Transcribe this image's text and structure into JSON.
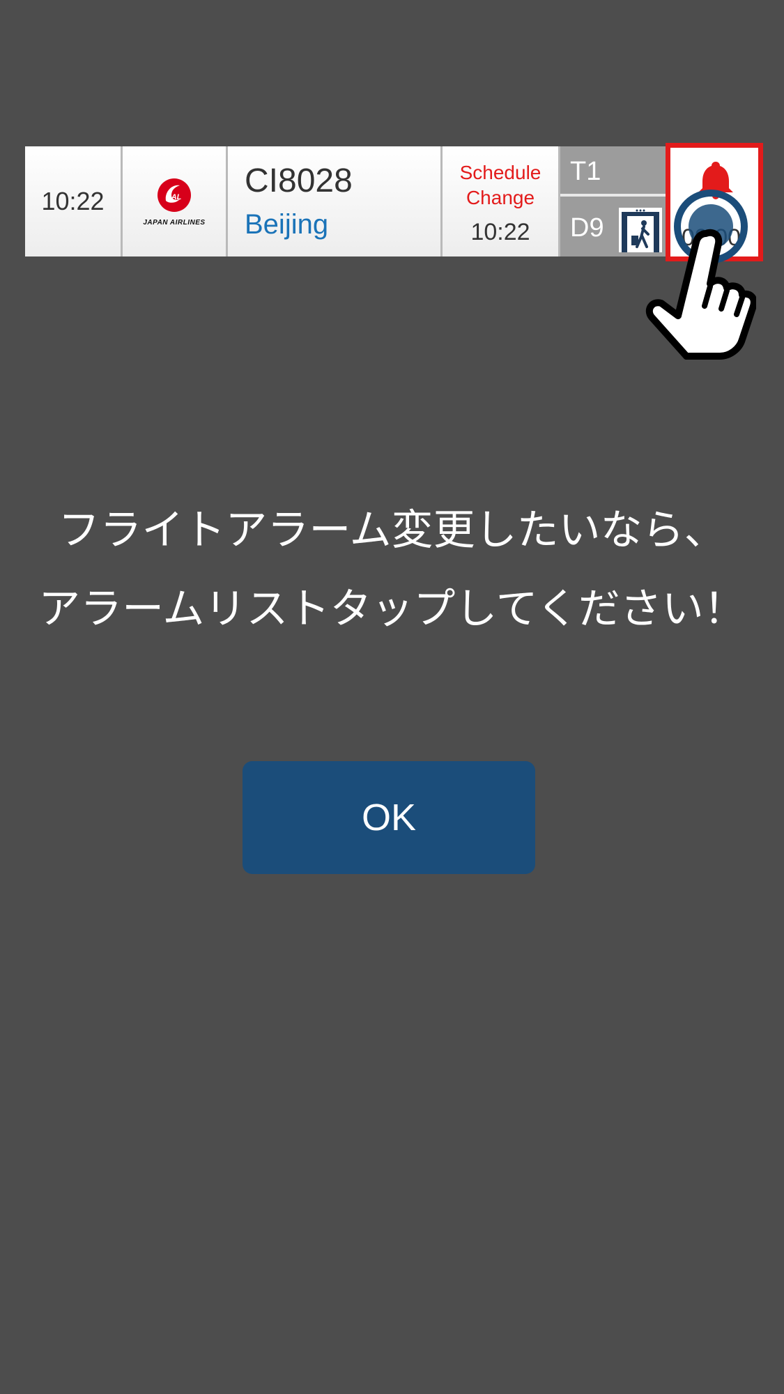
{
  "flight": {
    "scheduled_time": "10:22",
    "airline_logo_text": "JAL",
    "airline_wordmark": "JAPAN AIRLINES",
    "flight_number": "CI8028",
    "destination": "Beijing",
    "status_label": "Schedule\nChange",
    "status_time": "10:22",
    "terminal": "T1",
    "gate": "D9",
    "gate_icon": "boarding-gate-icon",
    "alarm_icon": "bell-icon",
    "alarm_time": "09:00"
  },
  "dialog": {
    "message_line1": "フライトアラーム変更したいなら、",
    "message_line2": "アラームリストタップしてください！",
    "ok_label": "OK"
  },
  "overlay": {
    "pointer_icon": "hand-pointer-icon",
    "tap_indicator": "tap-ring-icon"
  },
  "colors": {
    "background": "#4d4d4d",
    "accent_red": "#e31b1b",
    "button_blue": "#1b4d7a",
    "link_blue": "#1a73b8"
  }
}
